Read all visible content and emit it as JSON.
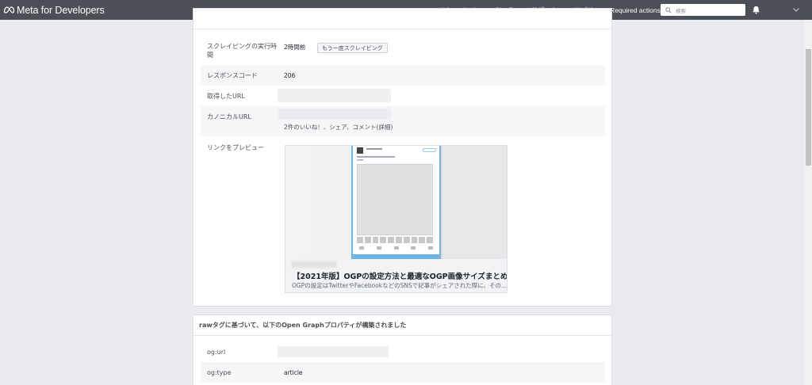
{
  "header": {
    "brand": "Meta for Developers",
    "nav": [
      "ドキュメント",
      "ツール",
      "サポート",
      "アプリ",
      "Required actions"
    ],
    "search_placeholder": "検索"
  },
  "scrape_card": {
    "rows": [
      {
        "label": "スクレイピングの実行時間",
        "value": "2時間前",
        "button": "もう一度スクレイピング"
      },
      {
        "label": "レスポンスコード",
        "value": "206"
      },
      {
        "label": "取得したURL",
        "value": ""
      },
      {
        "label": "カノニカルURL",
        "value": "2件のいいね！、シェア、コメント(詳細)"
      },
      {
        "label": "リンクをプレビュー"
      }
    ],
    "preview": {
      "title": "【2021年版】OGPの設定方法と最適なOGP画像サイズまとめ",
      "description": "OGPの設定はTwitterやFacebookなどのSNSで記事がシェアされた際に、その..."
    }
  },
  "og_card": {
    "title": "rawタグに基づいて、以下のOpen Graphプロパティが構築されました",
    "rows": [
      {
        "label": "og:url",
        "value": ""
      },
      {
        "label": "og:type",
        "value": "article"
      }
    ]
  }
}
